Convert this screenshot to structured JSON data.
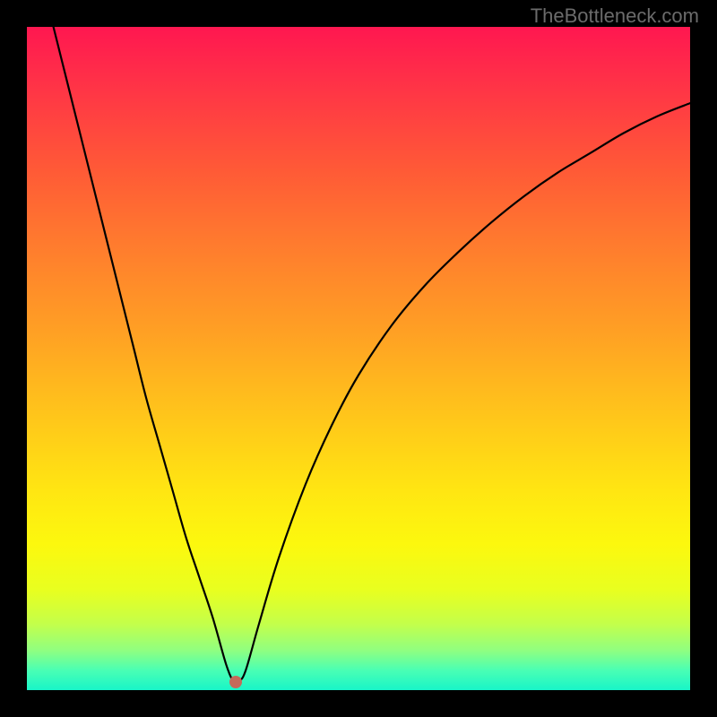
{
  "watermark": "TheBottleneck.com",
  "chart_data": {
    "type": "line",
    "title": "",
    "xlabel": "",
    "ylabel": "",
    "xlim": [
      0,
      100
    ],
    "ylim": [
      0,
      100
    ],
    "grid": false,
    "series": [
      {
        "name": "bottleneck-curve",
        "x": [
          4,
          5,
          6,
          8,
          10,
          12,
          14,
          16,
          18,
          20,
          22,
          24,
          26,
          28,
          30,
          31,
          31.5,
          32,
          33,
          35,
          38,
          42,
          46,
          50,
          55,
          60,
          65,
          70,
          75,
          80,
          85,
          90,
          95,
          100
        ],
        "values": [
          100,
          96,
          92,
          84,
          76,
          68,
          60,
          52,
          44,
          37,
          30,
          23,
          17,
          11,
          4,
          1.5,
          1.2,
          1.3,
          3,
          10,
          20,
          31,
          40,
          47.5,
          55,
          61,
          66,
          70.5,
          74.5,
          78,
          81,
          84,
          86.5,
          88.5
        ]
      }
    ],
    "annotations": [
      {
        "name": "minimum-point",
        "x": 31.5,
        "y": 1.2
      }
    ],
    "colors": {
      "curve": "#000000",
      "minimum_marker": "#c46a5a",
      "gradient_top": "#ff1750",
      "gradient_bottom": "#18f5c8"
    }
  }
}
